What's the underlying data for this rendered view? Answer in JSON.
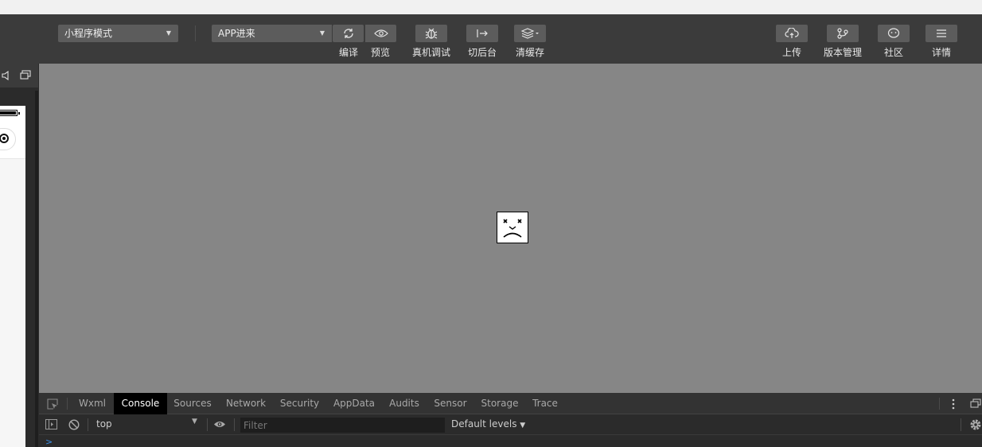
{
  "toolbar": {
    "mode_select": "小程序模式",
    "compile_select": "APP进来",
    "buttons": {
      "compile": "编译",
      "preview": "预览",
      "remote_debug": "真机调试",
      "background": "切后台",
      "clear_cache": "清缓存",
      "upload": "上传",
      "version": "版本管理",
      "community": "社区",
      "details": "详情"
    }
  },
  "devtools": {
    "tabs": [
      "Wxml",
      "Console",
      "Sources",
      "Network",
      "Security",
      "AppData",
      "Audits",
      "Sensor",
      "Storage",
      "Trace"
    ],
    "active_tab": "Console",
    "context": "top",
    "filter_placeholder": "Filter",
    "levels": "Default levels",
    "prompt": ">"
  },
  "colors": {
    "toolbar_bg": "#3b3b3b",
    "button_bg": "#5c5c5c",
    "simulator_bg": "#868686",
    "active_tab_bg": "#000000"
  }
}
